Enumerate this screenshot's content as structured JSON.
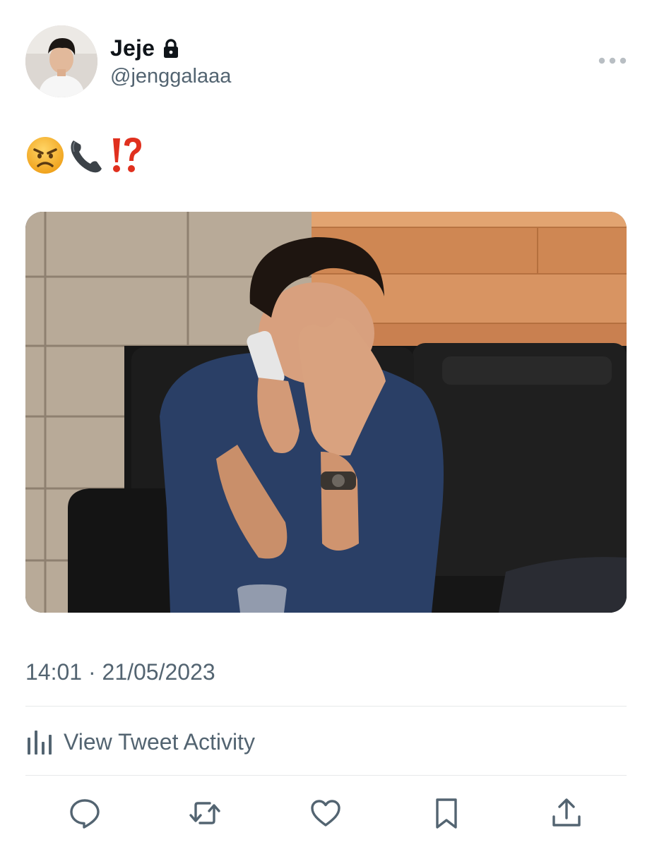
{
  "user": {
    "display_name": "Jeje",
    "handle": "@jenggalaaa",
    "protected_icon": "lock-icon"
  },
  "tweet": {
    "text": "😠📞⁉️",
    "timestamp": "14:01 · 21/05/2023"
  },
  "activity": {
    "label": "View Tweet Activity",
    "icon": "bar-chart-icon"
  },
  "actions": [
    {
      "name": "reply",
      "icon": "speech-bubble-icon"
    },
    {
      "name": "retweet",
      "icon": "retweet-arrows-icon"
    },
    {
      "name": "like",
      "icon": "heart-icon"
    },
    {
      "name": "bookmark",
      "icon": "bookmark-icon"
    },
    {
      "name": "share",
      "icon": "share-upload-icon"
    }
  ],
  "colors": {
    "text_primary": "#0f1419",
    "text_secondary": "#536471",
    "divider": "#e7e9ea",
    "action_icon": "#536471"
  }
}
